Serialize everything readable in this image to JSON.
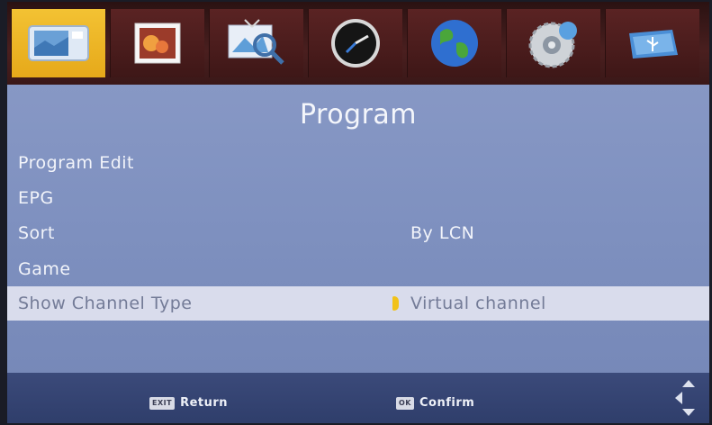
{
  "menu": {
    "tabs": [
      {
        "icon": "tv-screen-icon",
        "active": true
      },
      {
        "icon": "picture-icon",
        "active": false
      },
      {
        "icon": "search-image-icon",
        "active": false
      },
      {
        "icon": "clock-icon",
        "active": false
      },
      {
        "icon": "globe-icon",
        "active": false
      },
      {
        "icon": "settings-disc-icon",
        "active": false
      },
      {
        "icon": "usb-icon",
        "active": false
      }
    ]
  },
  "page": {
    "title": "Program",
    "items": [
      {
        "label": "Program Edit",
        "value": ""
      },
      {
        "label": "EPG",
        "value": ""
      },
      {
        "label": "Sort",
        "value": "By LCN"
      },
      {
        "label": "Game",
        "value": ""
      },
      {
        "label": "Show Channel Type",
        "value": "Virtual channel",
        "selected": true
      }
    ]
  },
  "footer": {
    "return_key": "EXIT",
    "return_label": "Return",
    "confirm_key": "OK",
    "confirm_label": "Confirm"
  }
}
